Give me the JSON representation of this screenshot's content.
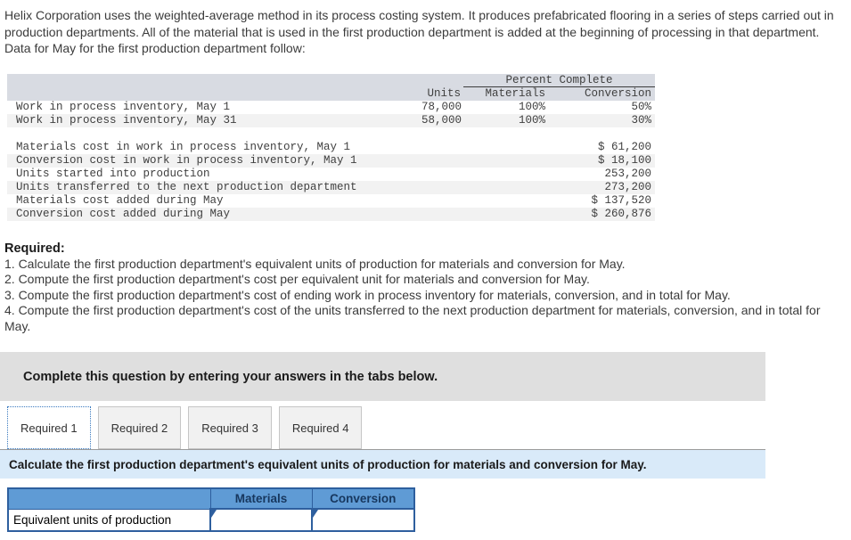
{
  "colors": {
    "accent_blue": "#5f9bd5",
    "table_border_blue": "#2e5f9e",
    "highlight_bar_blue": "#d9eaf9",
    "panel_gray": "#dfdfdf",
    "table_header_gray": "#d8dbe2",
    "stripe_gray": "#f2f2f2",
    "active_tab_dotted_border": "#3a7abf"
  },
  "problem": {
    "statement": "Helix Corporation uses the weighted-average method in its process costing system. It produces prefabricated flooring in a series of steps carried out in production departments. All of the material that is used in the first production department is added at the beginning of processing in that department. Data for May for the first production department follow:"
  },
  "data_table": {
    "header_group": "Percent Complete",
    "columns": [
      "Units",
      "Materials",
      "Conversion"
    ],
    "wip_rows": [
      {
        "label": "Work in process inventory, May 1",
        "units": "78,000",
        "materials": "100%",
        "conversion": "50%"
      },
      {
        "label": "Work in process inventory, May 31",
        "units": "58,000",
        "materials": "100%",
        "conversion": "30%"
      }
    ],
    "detail_rows": [
      {
        "label": "Materials cost in work in process inventory, May 1",
        "value": "$ 61,200"
      },
      {
        "label": "Conversion cost in work in process inventory, May 1",
        "value": "$ 18,100"
      },
      {
        "label": "Units started into production",
        "value": "253,200"
      },
      {
        "label": "Units transferred to the next production department",
        "value": "273,200"
      },
      {
        "label": "Materials cost added during May",
        "value": "$ 137,520"
      },
      {
        "label": "Conversion cost added during May",
        "value": "$ 260,876"
      }
    ]
  },
  "required": {
    "heading": "Required:",
    "items": [
      "1. Calculate the first production department's equivalent units of production for materials and conversion for May.",
      "2. Compute the first production department's cost per equivalent unit for materials and conversion for May.",
      "3. Compute the first production department's cost of ending work in process inventory for materials, conversion, and in total for May.",
      "4. Compute the first production department's cost of the units transferred to the next production department for materials, conversion, and in total for May."
    ]
  },
  "panel": {
    "instruction": "Complete this question by entering your answers in the tabs below."
  },
  "tabs": [
    {
      "label": "Required 1",
      "active": true
    },
    {
      "label": "Required 2",
      "active": false
    },
    {
      "label": "Required 3",
      "active": false
    },
    {
      "label": "Required 4",
      "active": false
    }
  ],
  "active_tab": {
    "instruction": "Calculate the first production department's equivalent units of production for materials and conversion for May."
  },
  "answer_table": {
    "columns": [
      "Materials",
      "Conversion"
    ],
    "row_label": "Equivalent units of production",
    "inputs": {
      "materials": "",
      "conversion": ""
    }
  }
}
